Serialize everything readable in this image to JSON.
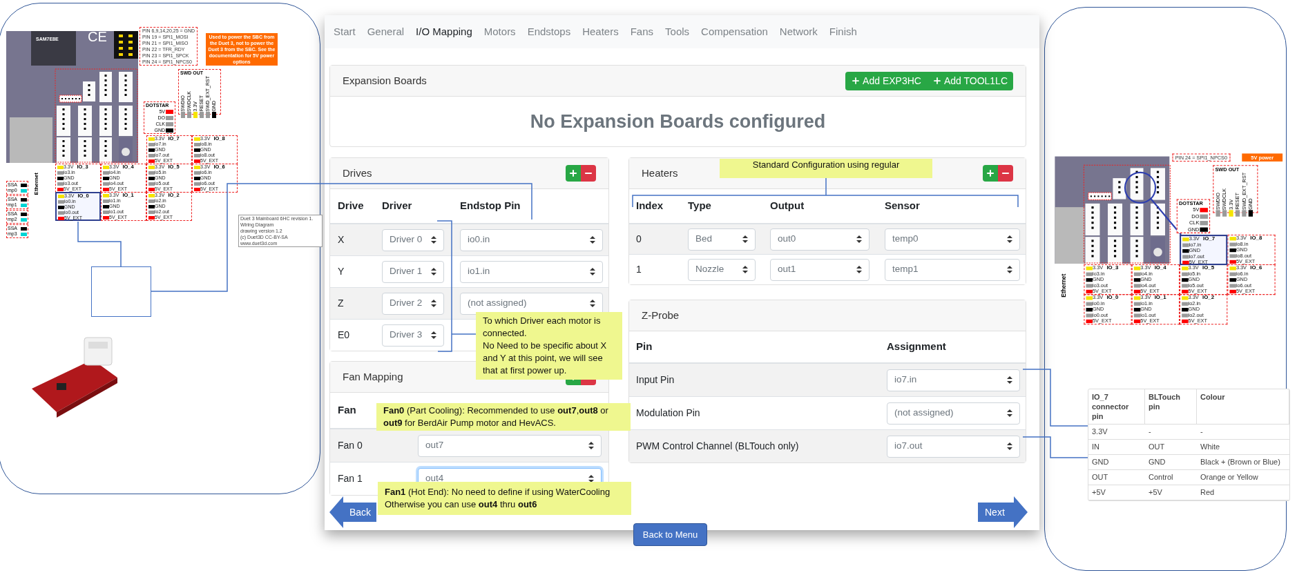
{
  "left_board": {
    "chip": "SAM7E8E",
    "mark": "CE",
    "pin_notes": [
      "PIN 6,9,14,20,25 = GND",
      "PIN 19 = SPI1_MOSI",
      "PIN 21 = SPI1_MISO",
      "PIN 22 = TFR_RDY",
      "PIN 23 = SPI1_SPCK",
      "PIN 24 = SPI1_NPCS0"
    ],
    "power_note": "Used to power the SBC from the Duet 3, not to power the Duet 3 from the SBC. See the documentation for 5V power options",
    "swd_out": {
      "title": "SWD OUT",
      "pins": [
        {
          "label": "SWDIO",
          "color": "#9a9a9a"
        },
        {
          "label": "SWDCLK",
          "color": "#9a9a9a"
        },
        {
          "label": "3.3V",
          "color": "#f5e400"
        },
        {
          "label": "RESET",
          "color": "#9a9a9a"
        },
        {
          "label": "SWD_EXT_RST",
          "color": "#9a9a9a"
        },
        {
          "label": "GND",
          "color": "#000000"
        }
      ]
    },
    "dotstar": {
      "title": "DOTSTAR",
      "pins": [
        {
          "label": "5V",
          "color": "#ff0000"
        },
        {
          "label": "DO",
          "color": "#9a9a9a"
        },
        {
          "label": "CLK",
          "color": "#9a9a9a"
        },
        {
          "label": "GND",
          "color": "#000000"
        }
      ]
    },
    "io_blocks": [
      {
        "name": "IO_7",
        "highlighted": false,
        "pins": [
          {
            "label": "3.3V",
            "color": "#f5e400"
          },
          {
            "label": "io7.in",
            "color": "#9a9a9a"
          },
          {
            "label": "GND",
            "color": "#000000"
          },
          {
            "label": "io7.out",
            "color": "#9a9a9a"
          },
          {
            "label": "5V_EXT",
            "color": "#ff0000"
          }
        ]
      },
      {
        "name": "IO_8",
        "highlighted": false,
        "pins": [
          {
            "label": "3.3V",
            "color": "#f5e400"
          },
          {
            "label": "io8.in",
            "color": "#9a9a9a"
          },
          {
            "label": "GND",
            "color": "#000000"
          },
          {
            "label": "io8.out",
            "color": "#9a9a9a"
          },
          {
            "label": "5V_EXT",
            "color": "#ff0000"
          }
        ]
      },
      {
        "name": "IO_3",
        "highlighted": false,
        "pins": [
          {
            "label": "3.3V",
            "color": "#f5e400"
          },
          {
            "label": "io3.in",
            "color": "#9a9a9a"
          },
          {
            "label": "GND",
            "color": "#000000"
          },
          {
            "label": "io3.out",
            "color": "#9a9a9a"
          },
          {
            "label": "5V_EXT",
            "color": "#ff0000"
          }
        ]
      },
      {
        "name": "IO_4",
        "highlighted": false,
        "pins": [
          {
            "label": "3.3V",
            "color": "#f5e400"
          },
          {
            "label": "io4.in",
            "color": "#9a9a9a"
          },
          {
            "label": "GND",
            "color": "#000000"
          },
          {
            "label": "io4.out",
            "color": "#9a9a9a"
          },
          {
            "label": "5V_EXT",
            "color": "#ff0000"
          }
        ]
      },
      {
        "name": "IO_5",
        "highlighted": false,
        "pins": [
          {
            "label": "3.3V",
            "color": "#f5e400"
          },
          {
            "label": "io5.in",
            "color": "#9a9a9a"
          },
          {
            "label": "GND",
            "color": "#000000"
          },
          {
            "label": "io5.out",
            "color": "#9a9a9a"
          },
          {
            "label": "5V_EXT",
            "color": "#ff0000"
          }
        ]
      },
      {
        "name": "IO_6",
        "highlighted": false,
        "pins": [
          {
            "label": "3.3V",
            "color": "#f5e400"
          },
          {
            "label": "io6.in",
            "color": "#9a9a9a"
          },
          {
            "label": "GND",
            "color": "#000000"
          },
          {
            "label": "io6.out",
            "color": "#9a9a9a"
          },
          {
            "label": "5V_EXT",
            "color": "#ff0000"
          }
        ]
      },
      {
        "name": "IO_0",
        "highlighted": true,
        "pins": [
          {
            "label": "3.3V",
            "color": "#f5e400"
          },
          {
            "label": "io0.in",
            "color": "#9a9a9a"
          },
          {
            "label": "GND",
            "color": "#000000"
          },
          {
            "label": "io0.out",
            "color": "#9a9a9a"
          },
          {
            "label": "5V_EXT",
            "color": "#ff0000"
          }
        ]
      },
      {
        "name": "IO_1",
        "highlighted": false,
        "pins": [
          {
            "label": "3.3V",
            "color": "#f5e400"
          },
          {
            "label": "io1.in",
            "color": "#9a9a9a"
          },
          {
            "label": "GND",
            "color": "#000000"
          },
          {
            "label": "io1.out",
            "color": "#9a9a9a"
          },
          {
            "label": "5V_EXT",
            "color": "#ff0000"
          }
        ]
      },
      {
        "name": "IO_2",
        "highlighted": false,
        "pins": [
          {
            "label": "3.3V",
            "color": "#f5e400"
          },
          {
            "label": "io2.in",
            "color": "#9a9a9a"
          },
          {
            "label": "GND",
            "color": "#000000"
          },
          {
            "label": "io2.out",
            "color": "#9a9a9a"
          },
          {
            "label": "5V_EXT",
            "color": "#ff0000"
          }
        ]
      }
    ],
    "analog_stubs": [
      {
        "pins": [
          {
            "label": "SSA",
            "color": "#000000"
          },
          {
            "label": "mp0",
            "color": "#00d4d4"
          }
        ]
      },
      {
        "pins": [
          {
            "label": "SSA",
            "color": "#000000"
          },
          {
            "label": "mp1",
            "color": "#00d4d4"
          }
        ]
      },
      {
        "pins": [
          {
            "label": "SSA",
            "color": "#000000"
          },
          {
            "label": "mp2",
            "color": "#00d4d4"
          }
        ]
      },
      {
        "pins": [
          {
            "label": "SSA",
            "color": "#000000"
          },
          {
            "label": "mp3",
            "color": "#00d4d4"
          }
        ]
      }
    ],
    "side_label": "Ethernet",
    "credits": [
      "Duet 3 Mainboard 6HC revision 1.",
      "Wiring Diagram",
      "drawing version 1.2",
      "(c) Duet3D CC-BY-SA",
      "www.duet3d.com"
    ]
  },
  "wizard": {
    "tabs": [
      {
        "label": "Start",
        "selected": false
      },
      {
        "label": "General",
        "selected": false
      },
      {
        "label": "I/O Mapping",
        "selected": true
      },
      {
        "label": "Motors",
        "selected": false
      },
      {
        "label": "Endstops",
        "selected": false
      },
      {
        "label": "Heaters",
        "selected": false
      },
      {
        "label": "Fans",
        "selected": false
      },
      {
        "label": "Tools",
        "selected": false
      },
      {
        "label": "Compensation",
        "selected": false
      },
      {
        "label": "Network",
        "selected": false
      },
      {
        "label": "Finish",
        "selected": false
      }
    ],
    "expansion": {
      "title": "Expansion Boards",
      "buttons": [
        "Add EXP3HC",
        "Add TOOL1LC"
      ],
      "empty_message": "No Expansion Boards configured"
    },
    "drives": {
      "title": "Drives",
      "columns": [
        "Drive",
        "Driver",
        "Endstop Pin"
      ],
      "rows": [
        {
          "drive": "X",
          "driver": "Driver 0",
          "endstop": "io0.in"
        },
        {
          "drive": "Y",
          "driver": "Driver 1",
          "endstop": "io1.in"
        },
        {
          "drive": "Z",
          "driver": "Driver 2",
          "endstop": "(not assigned)"
        },
        {
          "drive": "E0",
          "driver": "Driver 3"
        }
      ]
    },
    "fans": {
      "title": "Fan Mapping",
      "columns": [
        "Fan"
      ],
      "rows": [
        {
          "fan": "Fan 0",
          "output": "out7",
          "focused": false
        },
        {
          "fan": "Fan 1",
          "output": "out4",
          "focused": true
        }
      ]
    },
    "heaters": {
      "title": "Heaters",
      "columns": [
        "Index",
        "Type",
        "Output",
        "Sensor"
      ],
      "rows": [
        {
          "index": "0",
          "type": "Bed",
          "output": "out0",
          "sensor": "temp0"
        },
        {
          "index": "1",
          "type": "Nozzle",
          "output": "out1",
          "sensor": "temp1"
        }
      ]
    },
    "z_probe": {
      "title": "Z-Probe",
      "columns": [
        "Pin",
        "Assignment"
      ],
      "rows": [
        {
          "pin": "Input Pin",
          "assignment": "io7.in"
        },
        {
          "pin": "Modulation Pin",
          "assignment": "(not assigned)"
        },
        {
          "pin": "PWM Control Channel (BLTouch only)",
          "assignment": "io7.out"
        }
      ]
    },
    "back": "Back",
    "next": "Next",
    "menu": "Back to Menu"
  },
  "callouts": [
    {
      "lines": [
        "Standard Configuration using regular"
      ]
    },
    {
      "lines": [
        "To which Driver each motor is connected.",
        "No Need to be specific about X and Y at this point, we will see that at first power up."
      ]
    },
    {
      "lines": [
        "**Fan0** (Part Cooling): Recommended to use **out7**,**out8** or **out9** for BerdAir Pump motor and HevACS."
      ]
    },
    {
      "lines": [
        "**Fan1** (Hot End): No need to define if using WaterCooling",
        "Otherwise you can use **out4** thru **out6**"
      ]
    }
  ],
  "right_board": {
    "pin_notes": [
      "PIN 24 = SPI1_NPCS0"
    ],
    "power_note": "5V power",
    "swd_out": {
      "title": "SWD OUT",
      "pins": [
        {
          "label": "SWDIO",
          "color": "#9a9a9a"
        },
        {
          "label": "SWDCLK",
          "color": "#9a9a9a"
        },
        {
          "label": "3.3V",
          "color": "#f5e400"
        },
        {
          "label": "RESET",
          "color": "#9a9a9a"
        },
        {
          "label": "SWD_EXT_RST",
          "color": "#9a9a9a"
        },
        {
          "label": "GND",
          "color": "#000000"
        }
      ]
    },
    "dotstar": {
      "title": "DOTSTAR",
      "pins": [
        {
          "label": "5V",
          "color": "#ff0000"
        },
        {
          "label": "DO",
          "color": "#9a9a9a"
        },
        {
          "label": "CLK",
          "color": "#9a9a9a"
        },
        {
          "label": "GND",
          "color": "#000000"
        }
      ]
    },
    "io_blocks": [
      {
        "name": "IO_7",
        "highlighted": true,
        "pins": [
          {
            "label": "3.3V",
            "color": "#f5e400"
          },
          {
            "label": "io7.in",
            "color": "#9a9a9a"
          },
          {
            "label": "GND",
            "color": "#000000"
          },
          {
            "label": "io7.out",
            "color": "#9a9a9a"
          },
          {
            "label": "5V_EXT",
            "color": "#ff0000"
          }
        ]
      },
      {
        "name": "IO_8",
        "highlighted": false,
        "pins": [
          {
            "label": "3.3V",
            "color": "#f5e400"
          },
          {
            "label": "io8.in",
            "color": "#9a9a9a"
          },
          {
            "label": "GND",
            "color": "#000000"
          },
          {
            "label": "io8.out",
            "color": "#9a9a9a"
          },
          {
            "label": "5V_EXT",
            "color": "#ff0000"
          }
        ]
      },
      {
        "name": "IO_3",
        "highlighted": false,
        "pins": [
          {
            "label": "3.3V",
            "color": "#f5e400"
          },
          {
            "label": "io3.in",
            "color": "#9a9a9a"
          },
          {
            "label": "GND",
            "color": "#000000"
          },
          {
            "label": "io3.out",
            "color": "#9a9a9a"
          },
          {
            "label": "5V_EXT",
            "color": "#ff0000"
          }
        ]
      },
      {
        "name": "IO_4",
        "highlighted": false,
        "pins": [
          {
            "label": "3.3V",
            "color": "#f5e400"
          },
          {
            "label": "io4.in",
            "color": "#9a9a9a"
          },
          {
            "label": "GND",
            "color": "#000000"
          },
          {
            "label": "io4.out",
            "color": "#9a9a9a"
          },
          {
            "label": "5V_EXT",
            "color": "#ff0000"
          }
        ]
      },
      {
        "name": "IO_5",
        "highlighted": false,
        "pins": [
          {
            "label": "3.3V",
            "color": "#f5e400"
          },
          {
            "label": "io5.in",
            "color": "#9a9a9a"
          },
          {
            "label": "GND",
            "color": "#000000"
          },
          {
            "label": "io5.out",
            "color": "#9a9a9a"
          },
          {
            "label": "5V_EXT",
            "color": "#ff0000"
          }
        ]
      },
      {
        "name": "IO_6",
        "highlighted": false,
        "pins": [
          {
            "label": "3.3V",
            "color": "#f5e400"
          },
          {
            "label": "io6.in",
            "color": "#9a9a9a"
          },
          {
            "label": "GND",
            "color": "#000000"
          },
          {
            "label": "io6.out",
            "color": "#9a9a9a"
          },
          {
            "label": "5V_EXT",
            "color": "#ff0000"
          }
        ]
      },
      {
        "name": "IO_0",
        "highlighted": false,
        "pins": [
          {
            "label": "3.3V",
            "color": "#f5e400"
          },
          {
            "label": "io0.in",
            "color": "#9a9a9a"
          },
          {
            "label": "GND",
            "color": "#000000"
          },
          {
            "label": "io0.out",
            "color": "#9a9a9a"
          },
          {
            "label": "5V_EXT",
            "color": "#ff0000"
          }
        ]
      },
      {
        "name": "IO_1",
        "highlighted": false,
        "pins": [
          {
            "label": "3.3V",
            "color": "#f5e400"
          },
          {
            "label": "io1.in",
            "color": "#9a9a9a"
          },
          {
            "label": "GND",
            "color": "#000000"
          },
          {
            "label": "io1.out",
            "color": "#9a9a9a"
          },
          {
            "label": "5V_EXT",
            "color": "#ff0000"
          }
        ]
      },
      {
        "name": "IO_2",
        "highlighted": false,
        "pins": [
          {
            "label": "3.3V",
            "color": "#f5e400"
          },
          {
            "label": "io2.in",
            "color": "#9a9a9a"
          },
          {
            "label": "GND",
            "color": "#000000"
          },
          {
            "label": "io2.out",
            "color": "#9a9a9a"
          },
          {
            "label": "5V_EXT",
            "color": "#ff0000"
          }
        ]
      }
    ],
    "side_label": "Ethernet"
  },
  "pin_table": {
    "columns": [
      "IO_7 connector pin",
      "BLTouch pin",
      "Colour"
    ],
    "rows": [
      [
        "3.3V",
        "-",
        "-"
      ],
      [
        "IN",
        "OUT",
        "White"
      ],
      [
        "GND",
        "GND",
        "Black + (Brown or Blue)"
      ],
      [
        "OUT",
        "Control",
        "Orange or Yellow"
      ],
      [
        "+5V",
        "+5V",
        "Red"
      ]
    ]
  }
}
